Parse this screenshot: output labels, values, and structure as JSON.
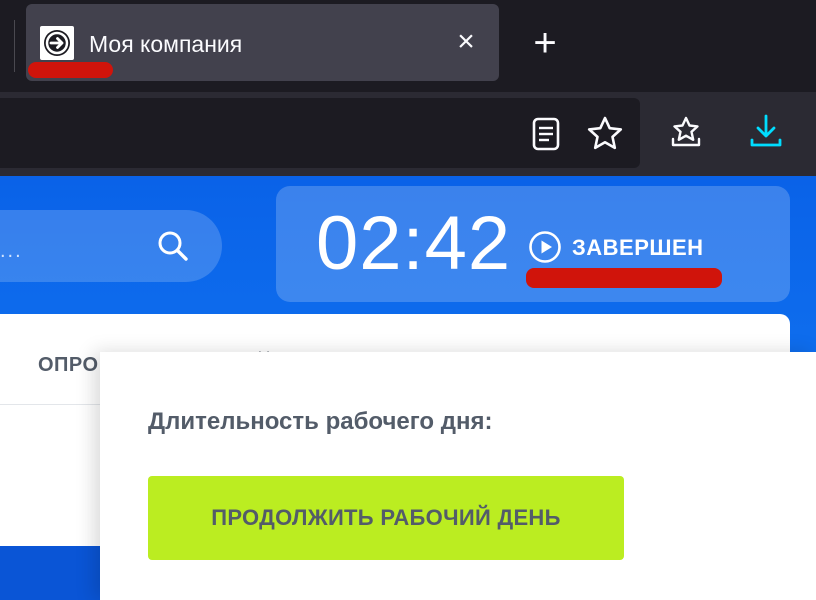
{
  "browser": {
    "tab": {
      "title": "Моя компания",
      "favicon": "arrow-circle-icon",
      "close_label": "×"
    },
    "new_tab_label": "+",
    "toolbar_icons": [
      "reader-view-icon",
      "bookmark-star-icon",
      "saved-pages-star-icon",
      "download-icon"
    ],
    "colors": {
      "tab_bg": "#42414d",
      "chrome_bg": "#1c1b22",
      "toolbar_bg": "#2b2a33",
      "download_accent": "#00ddff"
    }
  },
  "page": {
    "search": {
      "placeholder": "..."
    },
    "timer": {
      "time": "02:42",
      "status_label": "ЗАВЕРШЕН",
      "status_icon": "play-circle-icon"
    },
    "content_tabs": [
      {
        "label": "ОПРО"
      }
    ],
    "popup": {
      "title": "Длительность рабочего дня:",
      "continue_button_label": "ПРОДОЛЖИТЬ РАБОЧИЙ ДЕНЬ"
    },
    "colors": {
      "page_bg": "#0a62e8",
      "button_green": "#bbed21",
      "text_gray": "#535c69",
      "annotation_red": "#d0140b"
    }
  }
}
